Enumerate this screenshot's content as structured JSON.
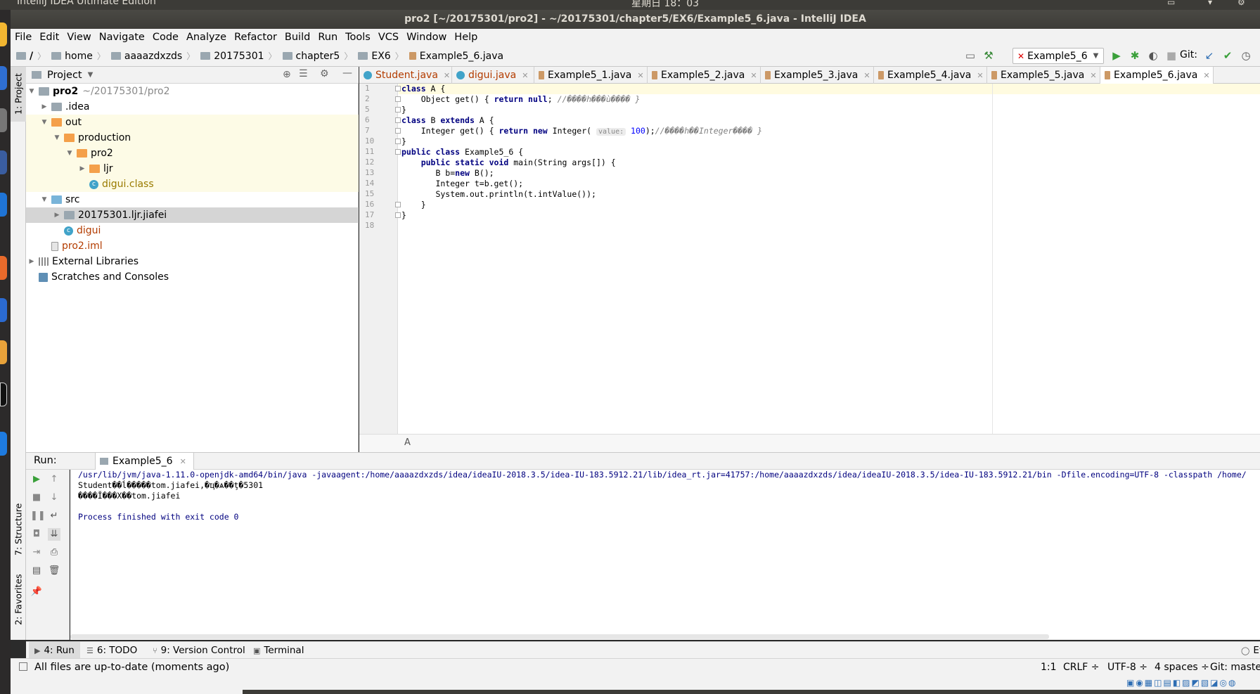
{
  "os": {
    "app_name": "IntelliJ IDEA Ultimate Edition",
    "clock": "星期日 18：03"
  },
  "window": {
    "title": "pro2 [~/20175301/pro2] - ~/20175301/chapter5/EX6/Example5_6.java - IntelliJ IDEA"
  },
  "menu": [
    "File",
    "Edit",
    "View",
    "Navigate",
    "Code",
    "Analyze",
    "Refactor",
    "Build",
    "Run",
    "Tools",
    "VCS",
    "Window",
    "Help"
  ],
  "breadcrumb": [
    "/",
    "home",
    "aaaazdxzds",
    "20175301",
    "chapter5",
    "EX6",
    "Example5_6.java"
  ],
  "toolbar": {
    "run_config": "Example5_6",
    "git_label": "Git:"
  },
  "side_tabs": {
    "project": "1: Project",
    "structure": "7: Structure",
    "favorites": "2: Favorites"
  },
  "project": {
    "header": "Project",
    "tree": [
      {
        "label": "pro2",
        "sub": "~/20175301/pro2"
      },
      {
        "label": ".idea"
      },
      {
        "label": "out"
      },
      {
        "label": "production"
      },
      {
        "label": "pro2"
      },
      {
        "label": "ljr"
      },
      {
        "label": "digui.class"
      },
      {
        "label": "src"
      },
      {
        "label": "20175301.ljr.jiafei"
      },
      {
        "label": "digui"
      },
      {
        "label": "pro2.iml"
      },
      {
        "label": "External Libraries"
      },
      {
        "label": "Scratches and Consoles"
      }
    ]
  },
  "editor_tabs": [
    "Student.java",
    "digui.java",
    "Example5_1.java",
    "Example5_2.java",
    "Example5_3.java",
    "Example5_4.java",
    "Example5_5.java",
    "Example5_6.java"
  ],
  "editor": {
    "line_numbers": [
      "1",
      "2",
      "5",
      "6",
      "7",
      "10",
      "11",
      "12",
      "13",
      "14",
      "15",
      "16",
      "17",
      "18"
    ],
    "lines": [
      {
        "a": "class",
        "b": " A {"
      },
      {
        "a": "    Object get() { ",
        "k1": "return null",
        "b": "; ",
        "c": "//����h���ù���� }"
      },
      {
        "a": "}"
      },
      {
        "a": "class",
        "b": " B ",
        "k1": "extends",
        "c": " A {"
      },
      {
        "a": "    Integer get() { ",
        "k1": "return new",
        "b": " Integer( ",
        "hint": "value:",
        "n": " 100",
        "c": ");",
        "cm": "//����h��Integer���� }"
      },
      {
        "a": "}"
      },
      {
        "a": "public class",
        "b": " Example5_6 {"
      },
      {
        "a": "    ",
        "k1": "public static void",
        "b": " main(String args[]) {"
      },
      {
        "a": "       B b=",
        "k1": "new",
        "b": " B();"
      },
      {
        "a": "       Integer t=b.get();"
      },
      {
        "a": "       System.out.println(t.intValue());"
      },
      {
        "a": "    }"
      },
      {
        "a": "}"
      },
      {
        "a": ""
      }
    ],
    "footer_crumb": "A"
  },
  "run": {
    "label": "Run:",
    "tab": "Example5_6",
    "console": [
      "/usr/lib/jvm/java-1.11.0-openjdk-amd64/bin/java -javaagent:/home/aaaazdxzds/idea/ideaIU-2018.3.5/idea-IU-183.5912.21/lib/idea_rt.jar=41757:/home/aaaazdxzds/idea/ideaIU-2018.3.5/idea-IU-183.5912.21/bin -Dfile.encoding=UTF-8 -classpath /home/",
      "Student��ĺ�����tom.jiafei,�ҵ�ѧ��ţ�5301",
      "����Ĭ���X��tom.jiafei",
      "",
      "Process finished with exit code 0"
    ]
  },
  "bottom_tabs": [
    {
      "label": "4: Run"
    },
    {
      "label": "6: TODO"
    },
    {
      "label": "9: Version Control"
    },
    {
      "label": "Terminal"
    },
    {
      "label": "Ev"
    }
  ],
  "status": {
    "message": "All files are up-to-date (moments ago)",
    "position": "1:1",
    "line_sep": "CRLF ÷",
    "encoding": "UTF-8 ÷",
    "indent": "4 spaces ÷",
    "git": "Git: master ÷"
  }
}
